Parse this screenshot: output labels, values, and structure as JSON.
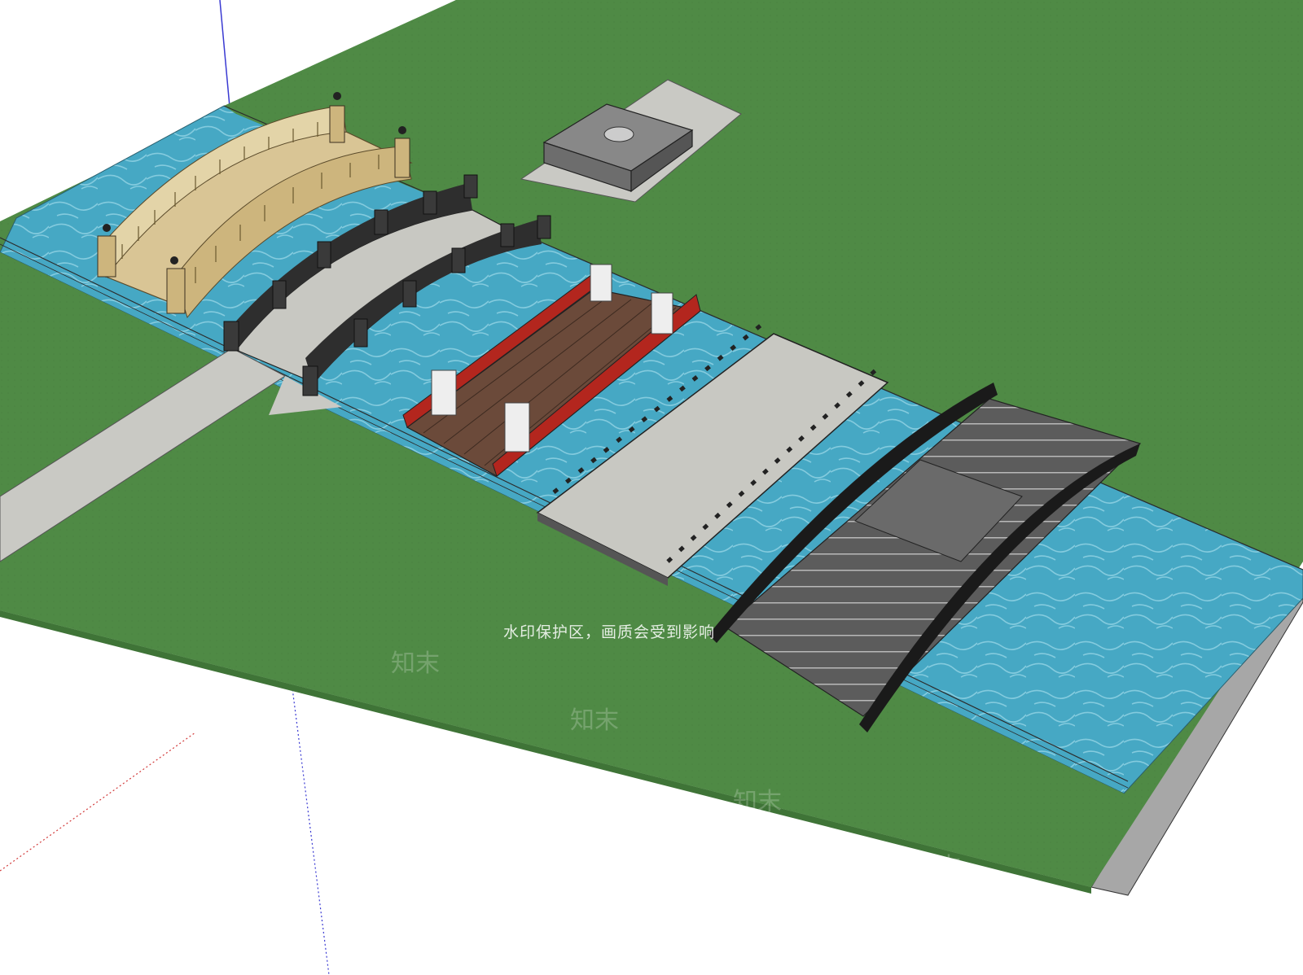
{
  "scene": {
    "type": "SketchUp 3D model viewport",
    "subject": "four footbridge models over a water channel on a grass plane",
    "colors": {
      "background": "#ffffff",
      "grass": "#4f8a45",
      "grass_dark": "#3f7437",
      "water": "#46a8c4",
      "path": "#c9c9c4",
      "stone_light": "#c8c8c2",
      "stone_dark": "#2e2e2e",
      "wood": "#6b4a3a",
      "wood_red": "#b3261e",
      "marble_beige": "#d9c595",
      "axis_red": "#d23a3a",
      "axis_blue": "#3a3ad2"
    },
    "bridges": [
      {
        "name": "arched-balustrade-bridge",
        "material": "beige stone"
      },
      {
        "name": "dark-pillar-arch-bridge",
        "material": "grey stone with black pillars"
      },
      {
        "name": "red-railing-wooden-bridge",
        "material": "brown wood with red railing"
      },
      {
        "name": "flat-stone-slab-bridge",
        "material": "grey concrete"
      },
      {
        "name": "modern-arch-stair-bridge",
        "material": "dark grey metal"
      }
    ]
  },
  "watermark": {
    "notice": "水印保护区，画质会受到影响",
    "logo_text": "知末"
  }
}
